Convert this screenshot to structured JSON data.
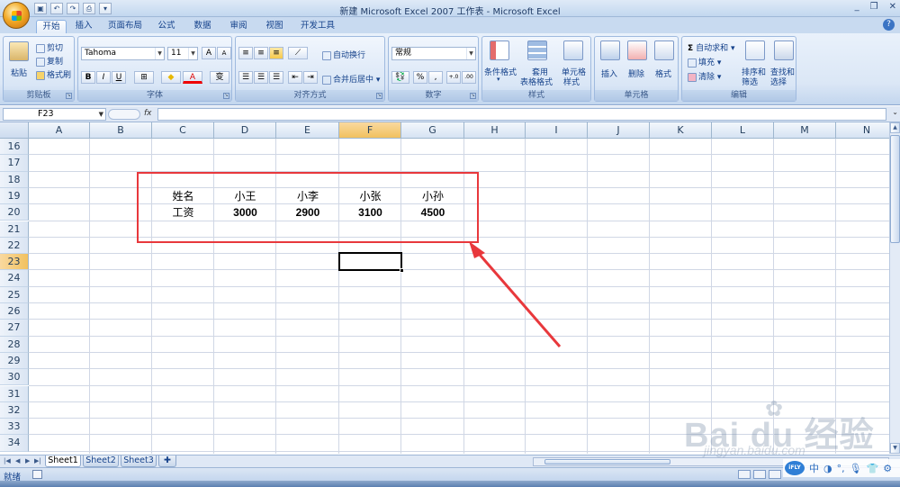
{
  "window": {
    "title": "新建 Microsoft Excel 2007 工作表 - Microsoft Excel",
    "controls": [
      "_",
      "❐",
      "✕"
    ]
  },
  "ribbon_tabs": [
    "开始",
    "插入",
    "页面布局",
    "公式",
    "数据",
    "审阅",
    "视图",
    "开发工具"
  ],
  "active_tab": "开始",
  "ribbon": {
    "clipboard": {
      "label": "剪贴板",
      "paste": "粘贴",
      "cut": "剪切",
      "copy": "复制",
      "format_painter": "格式刷"
    },
    "font": {
      "label": "字体",
      "name": "Tahoma",
      "size": "11",
      "bold": "B",
      "italic": "I",
      "underline": "U",
      "grow": "A",
      "shrink": "A",
      "font_color": "A",
      "fill_color": "◆",
      "border": "⊞",
      "phonetic": "变"
    },
    "alignment": {
      "label": "对齐方式",
      "wrap": "自动换行",
      "merge": "合并后居中"
    },
    "number": {
      "label": "数字",
      "format": "常规",
      "currency": "💱",
      "percent": "%",
      "comma": ",",
      "inc_dec": "+.0",
      "dec_dec": ".00"
    },
    "styles": {
      "label": "样式",
      "conditional": "条件格式",
      "table_format_1": "套用",
      "table_format_2": "表格格式",
      "cell_styles_1": "单元格",
      "cell_styles_2": "样式"
    },
    "cells": {
      "label": "单元格",
      "insert": "插入",
      "delete": "删除",
      "format": "格式"
    },
    "editing": {
      "label": "编辑",
      "autosum": "自动求和",
      "fill": "填充",
      "clear": "清除",
      "sort_1": "排序和",
      "sort_2": "筛选",
      "find_1": "查找和",
      "find_2": "选择",
      "sigma": "Σ"
    }
  },
  "formula_bar": {
    "name_box": "F23",
    "fx": "fx",
    "content": ""
  },
  "columns": [
    "A",
    "B",
    "C",
    "D",
    "E",
    "F",
    "G",
    "H",
    "I",
    "J",
    "K",
    "L",
    "M",
    "N"
  ],
  "selected_column": "F",
  "rows": [
    "16",
    "17",
    "18",
    "19",
    "20",
    "21",
    "22",
    "23",
    "24",
    "25",
    "26",
    "27",
    "28",
    "29",
    "30",
    "31",
    "32",
    "33",
    "34"
  ],
  "selected_row": "23",
  "cells": {
    "C19": "姓名",
    "D19": "小王",
    "E19": "小李",
    "F19": "小张",
    "G19": "小孙",
    "C20": "工资",
    "D20": "3000",
    "E20": "2900",
    "F20": "3100",
    "G20": "4500"
  },
  "sheets": [
    "Sheet1",
    "Sheet2",
    "Sheet3"
  ],
  "active_sheet": "Sheet1",
  "status": {
    "text": "就绪"
  },
  "ime": {
    "brand": "iFLY",
    "lang": "中",
    "moon": "◑",
    "punct": "°,",
    "mic": "🎙",
    "skin": "👕",
    "settings": "⚙"
  },
  "watermark": {
    "brand": "Bai du 经验",
    "site": "jingyan.baidu.com",
    "paw": "✿"
  },
  "colors": {
    "highlight": "#e8383c",
    "selected_header": "#f1c15f",
    "ribbon_bg": "#dbe7f6"
  }
}
